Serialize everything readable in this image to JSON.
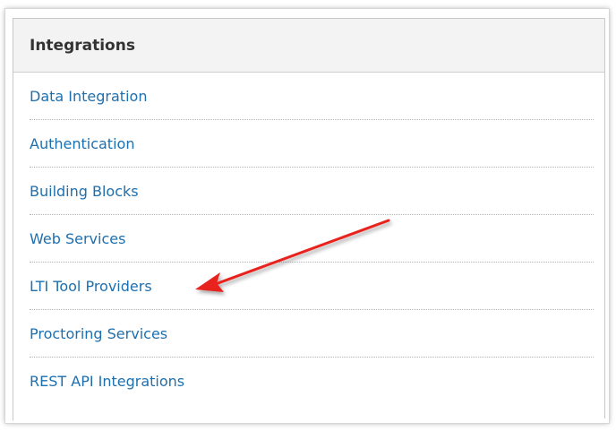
{
  "panel": {
    "title": "Integrations",
    "links": [
      {
        "label": "Data Integration"
      },
      {
        "label": "Authentication"
      },
      {
        "label": "Building Blocks"
      },
      {
        "label": "Web Services"
      },
      {
        "label": "LTI Tool Providers"
      },
      {
        "label": "Proctoring Services"
      },
      {
        "label": "REST API Integrations"
      }
    ]
  },
  "annotation": {
    "arrow_color": "#e8201c",
    "points_to": "LTI Tool Providers"
  },
  "colors": {
    "link": "#1e6fae",
    "header_bg": "#f3f3f3",
    "title": "#333333"
  }
}
